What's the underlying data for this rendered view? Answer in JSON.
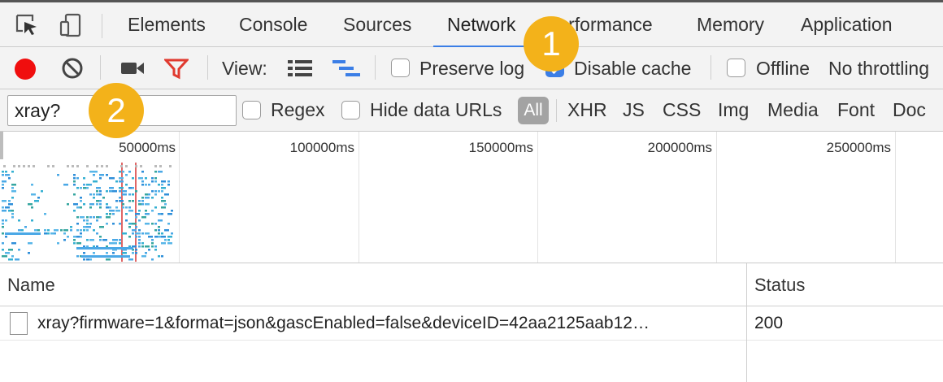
{
  "tabs": {
    "items": [
      "Elements",
      "Console",
      "Sources",
      "Network",
      "Performance",
      "Memory",
      "Application"
    ],
    "active": "Network"
  },
  "toolbar": {
    "view_label": "View:",
    "preserve_log": {
      "label": "Preserve log",
      "checked": false
    },
    "disable_cache": {
      "label": "Disable cache",
      "checked": true
    },
    "offline": {
      "label": "Offline",
      "checked": false
    },
    "throttling": "No throttling",
    "record_color": "#f00e0e",
    "filter_icon_color": "#e03a2f"
  },
  "filterbar": {
    "filter_value": "xray?",
    "regex_label": "Regex",
    "hide_data_urls_label": "Hide data URLs",
    "all_label": "All",
    "types": [
      "XHR",
      "JS",
      "CSS",
      "Img",
      "Media",
      "Font",
      "Doc"
    ]
  },
  "overview": {
    "ticks": [
      "50000ms",
      "100000ms",
      "150000ms",
      "200000ms",
      "250000ms"
    ]
  },
  "table": {
    "columns": {
      "name": "Name",
      "status": "Status"
    },
    "rows": [
      {
        "name": "xray?firmware=1&format=json&gascEnabled=false&deviceID=42aa2125aab12…",
        "status": "200"
      }
    ]
  },
  "callouts": {
    "one": "1",
    "two": "2",
    "color": "#f3b21a"
  }
}
